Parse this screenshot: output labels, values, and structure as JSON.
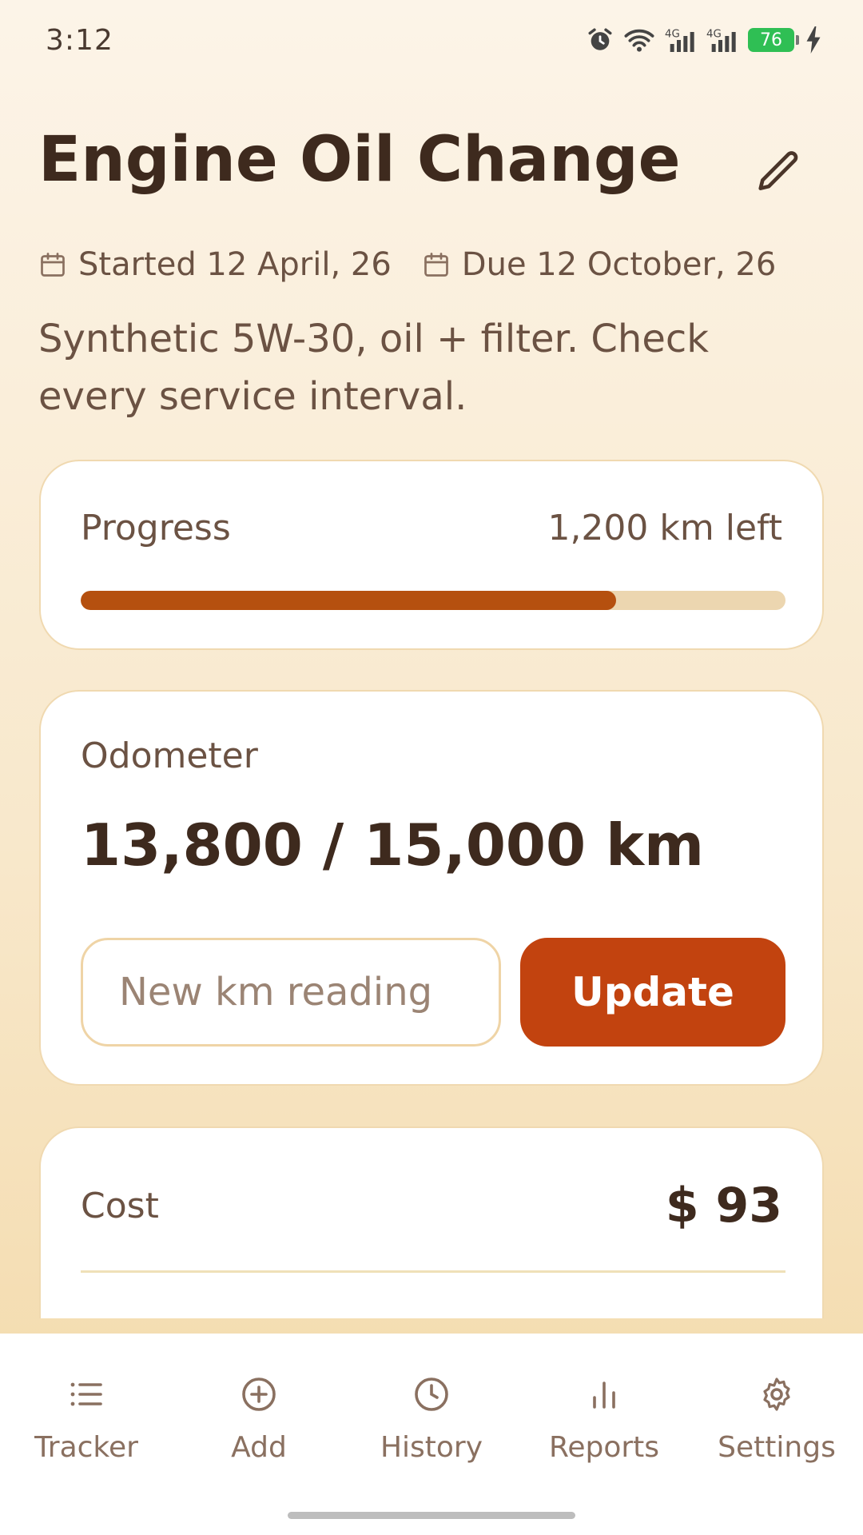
{
  "status_bar": {
    "time": "3:12",
    "battery": "76",
    "net_1": "4G",
    "net_2": "4G"
  },
  "header": {
    "title": "Engine Oil Change",
    "started": "Started 12 April, 26",
    "due": "Due 12 October, 26",
    "description": "Synthetic 5W-30, oil + filter. Check every service interval."
  },
  "progress_card": {
    "label": "Progress",
    "remaining": "1,200 km left",
    "fraction": 0.76
  },
  "odometer_card": {
    "label": "Odometer",
    "value": "13,800 / 15,000 km",
    "input_placeholder": "New km reading",
    "update_label": "Update"
  },
  "cost_card": {
    "label": "Cost",
    "value": "$ 93"
  },
  "nav": {
    "items": [
      {
        "label": "Tracker",
        "icon": "list-icon"
      },
      {
        "label": "Add",
        "icon": "plus-circle-icon"
      },
      {
        "label": "History",
        "icon": "clock-icon"
      },
      {
        "label": "Reports",
        "icon": "bar-chart-icon"
      },
      {
        "label": "Settings",
        "icon": "gear-icon"
      }
    ]
  },
  "colors": {
    "accent": "#c2430f",
    "progress_fill": "#b5500f",
    "progress_track": "#ecd6b0",
    "text_dark": "#3e2a1e",
    "text_muted": "#6b5243"
  }
}
